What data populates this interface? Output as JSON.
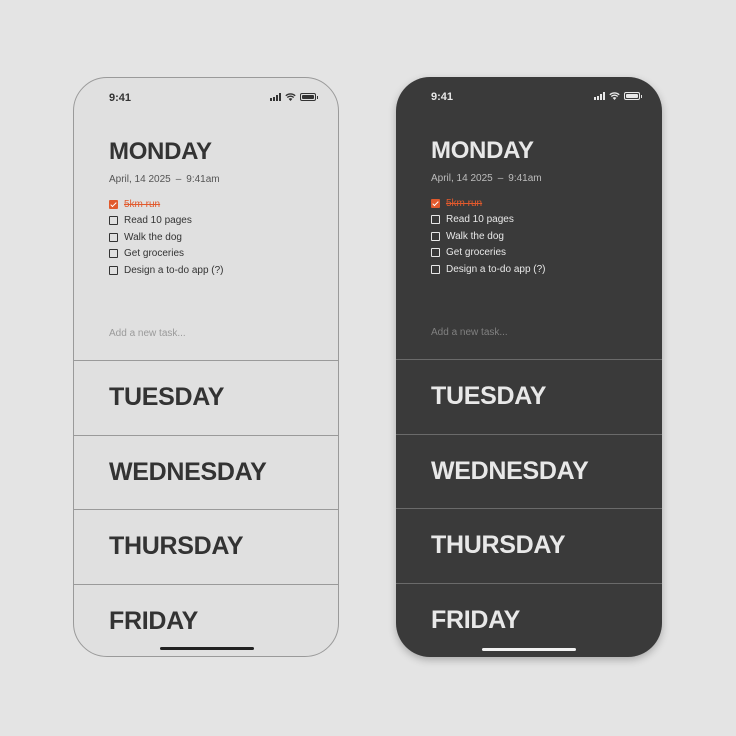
{
  "light": {
    "status": {
      "time": "9:41"
    },
    "today": {
      "title": "MONDAY",
      "date": "April, 14 2025",
      "separator": "–",
      "time": "9:41am"
    },
    "tasks": [
      {
        "label": "5km run",
        "checked": true
      },
      {
        "label": "Read 10 pages",
        "checked": false
      },
      {
        "label": "Walk the dog",
        "checked": false
      },
      {
        "label": "Get groceries",
        "checked": false
      },
      {
        "label": "Design a to-do app (?)",
        "checked": false
      }
    ],
    "add_task": {
      "placeholder": "Add a new task..."
    },
    "days": [
      "TUESDAY",
      "WEDNESDAY",
      "THURSDAY",
      "FRIDAY"
    ]
  },
  "dark": {
    "status": {
      "time": "9:41"
    },
    "today": {
      "title": "MONDAY",
      "date": "April, 14 2025",
      "separator": "–",
      "time": "9:41am"
    },
    "tasks": [
      {
        "label": "5km run",
        "checked": true
      },
      {
        "label": "Read 10 pages",
        "checked": false
      },
      {
        "label": "Walk the dog",
        "checked": false
      },
      {
        "label": "Get groceries",
        "checked": false
      },
      {
        "label": "Design a to-do app (?)",
        "checked": false
      }
    ],
    "add_task": {
      "placeholder": "Add a new task..."
    },
    "days": [
      "TUESDAY",
      "WEDNESDAY",
      "THURSDAY",
      "FRIDAY"
    ]
  },
  "colors": {
    "accent": "#e15a2d",
    "light_background": "#e0e0e0",
    "dark_background": "#3a3a3a",
    "page_background": "#e4e4e4"
  },
  "icons": {
    "signal": "cellular-signal-icon",
    "wifi": "wifi-icon",
    "battery": "battery-icon",
    "check": "checkmark-icon"
  }
}
